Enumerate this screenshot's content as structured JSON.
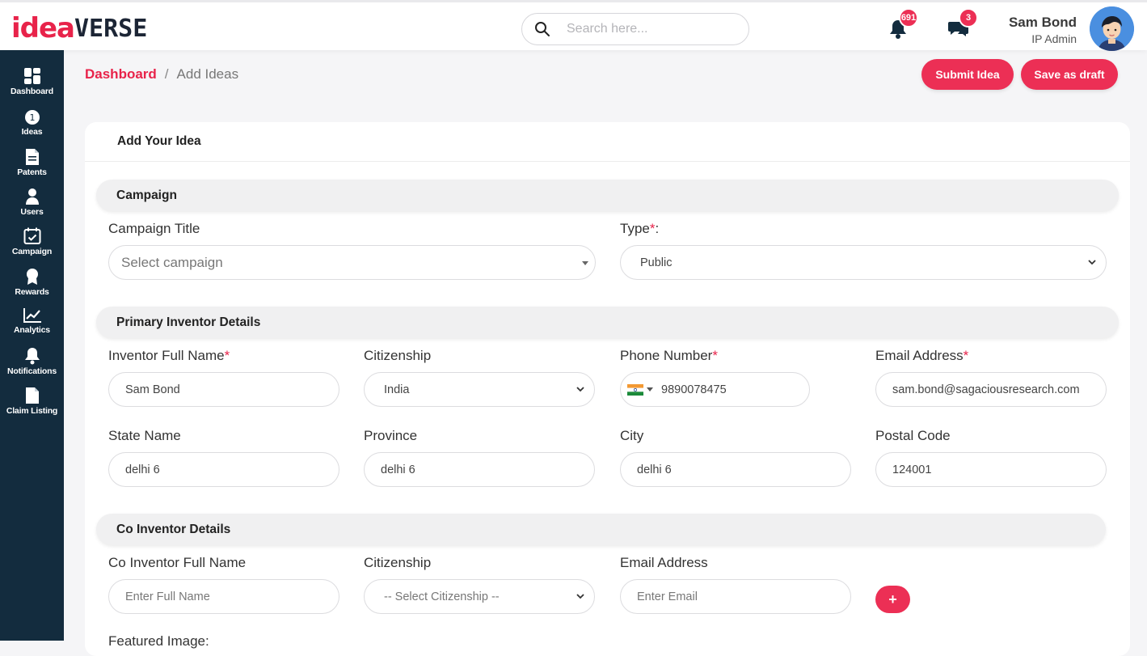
{
  "brand": {
    "logo_part1": "idea",
    "logo_part2": "VERSE"
  },
  "search": {
    "placeholder": "Search here..."
  },
  "notifications": {
    "bell_count": "691",
    "chat_count": "3"
  },
  "user": {
    "name": "Sam Bond",
    "role": "IP Admin"
  },
  "sidebar": {
    "items": [
      {
        "label": "Dashboard",
        "icon": "dashboard-icon"
      },
      {
        "label": "Ideas",
        "icon": "bulb-icon"
      },
      {
        "label": "Patents",
        "icon": "document-icon"
      },
      {
        "label": "Users",
        "icon": "user-icon"
      },
      {
        "label": "Campaign",
        "icon": "calendar-check-icon"
      },
      {
        "label": "Rewards",
        "icon": "award-icon"
      },
      {
        "label": "Analytics",
        "icon": "chart-icon"
      },
      {
        "label": "Notifications",
        "icon": "bell-icon"
      },
      {
        "label": "Claim Listing",
        "icon": "file-icon"
      }
    ]
  },
  "breadcrumb": {
    "root": "Dashboard",
    "separator": "/",
    "current": "Add Ideas"
  },
  "actions": {
    "submit": "Submit Idea",
    "draft": "Save as draft"
  },
  "card": {
    "title": "Add Your Idea"
  },
  "campaign": {
    "section": "Campaign",
    "title_label": "Campaign Title",
    "title_placeholder": "Select campaign",
    "type_label": "Type",
    "type_suffix": ":",
    "type_value": "Public"
  },
  "primary": {
    "section": "Primary Inventor Details",
    "name_label": "Inventor Full Name",
    "name_value": "Sam Bond",
    "citizenship_label": "Citizenship",
    "citizenship_value": "India",
    "phone_label": "Phone Number",
    "phone_value": "9890078475",
    "email_label": "Email Address",
    "email_value": "sam.bond@sagaciousresearch.com",
    "state_label": "State Name",
    "state_value": "delhi 6",
    "province_label": "Province",
    "province_value": "delhi 6",
    "city_label": "City",
    "city_value": "delhi 6",
    "postal_label": "Postal Code",
    "postal_value": "124001"
  },
  "co": {
    "section": "Co Inventor Details",
    "name_label": "Co Inventor Full Name",
    "name_placeholder": "Enter Full Name",
    "citizenship_label": "Citizenship",
    "citizenship_placeholder": "-- Select Citizenship --",
    "email_label": "Email Address",
    "email_placeholder": "Enter Email",
    "add_label": "+"
  },
  "featured": {
    "label": "Featured Image:"
  },
  "required_mark": "*",
  "colors": {
    "accent": "#ec2f55",
    "sidebar": "#132c3e"
  }
}
